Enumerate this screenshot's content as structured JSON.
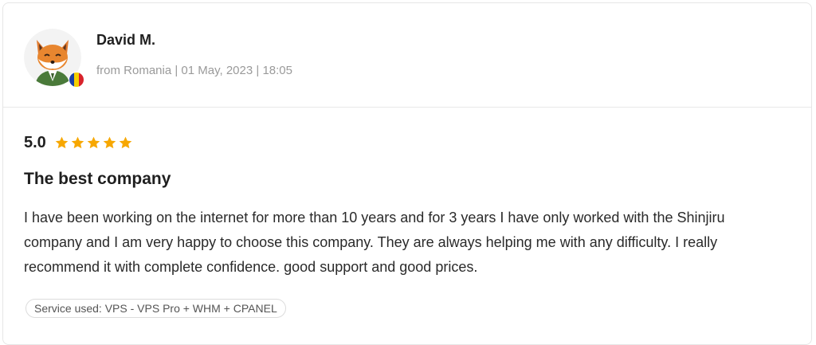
{
  "review": {
    "author": "David M.",
    "meta": "from Romania | 01 May, 2023 | 18:05",
    "avatar_icon": "fox-avatar-icon",
    "country_flag": "romania-flag-icon",
    "score": "5.0",
    "stars": 5,
    "star_color": "#f7a700",
    "title": "The best company",
    "body": "I have been working on the internet for more than 10 years and for 3 years I have only worked with the Shinjiru company and I am very happy to choose this company. They are always helping me with any difficulty. I really recommend it with complete confidence. good support and good prices.",
    "service_tag": "Service used: VPS - VPS Pro + WHM + CPANEL"
  }
}
